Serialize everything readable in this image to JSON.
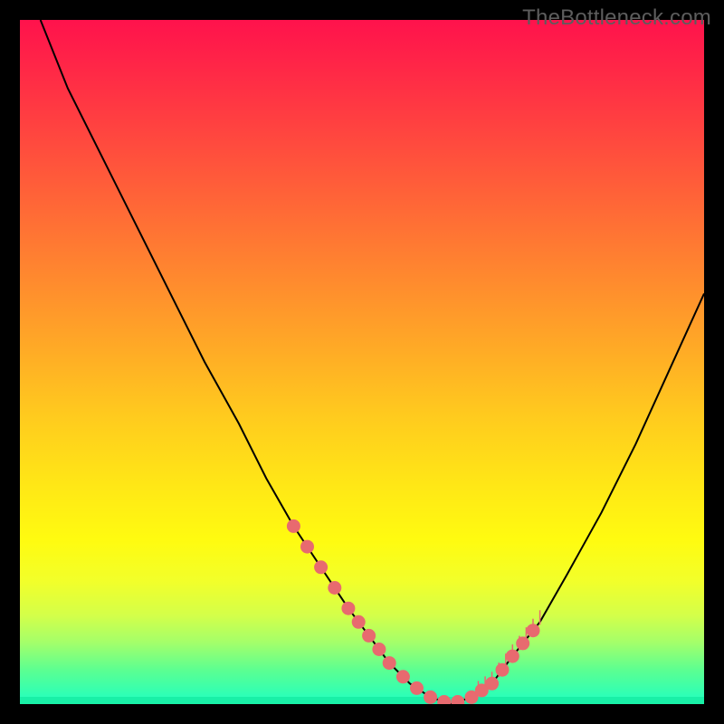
{
  "watermark": "TheBottleneck.com",
  "chart_data": {
    "type": "line",
    "title": "",
    "xlabel": "",
    "ylabel": "",
    "xlim": [
      0,
      100
    ],
    "ylim": [
      0,
      100
    ],
    "grid": false,
    "legend": false,
    "series": [
      {
        "name": "curve",
        "x": [
          3,
          7,
          12,
          17,
          22,
          27,
          32,
          36,
          40,
          44,
          48,
          51,
          54,
          57,
          60,
          63,
          66,
          69,
          72,
          76,
          80,
          85,
          90,
          95,
          100
        ],
        "values": [
          100,
          90,
          80,
          70,
          60,
          50,
          41,
          33,
          26,
          20,
          14,
          10,
          6,
          3,
          1,
          0,
          1,
          3,
          7,
          12,
          19,
          28,
          38,
          49,
          60
        ]
      }
    ],
    "branch_markers": {
      "left_x": [
        40,
        42,
        44,
        46,
        48,
        49.5,
        51,
        52.5
      ],
      "valley_x": [
        54,
        56,
        58,
        60,
        62,
        64,
        66
      ],
      "right_x": [
        67.5,
        69,
        70.5,
        72,
        73.5,
        75
      ],
      "tick_right_x": [
        67,
        68,
        69,
        70,
        71,
        72,
        73,
        74,
        75,
        76
      ]
    },
    "background_gradient_stops": [
      {
        "pos": 0.0,
        "color": "#ff124c"
      },
      {
        "pos": 0.5,
        "color": "#ffcb1e"
      },
      {
        "pos": 0.8,
        "color": "#fffb10"
      },
      {
        "pos": 1.0,
        "color": "#1effc2"
      }
    ]
  }
}
